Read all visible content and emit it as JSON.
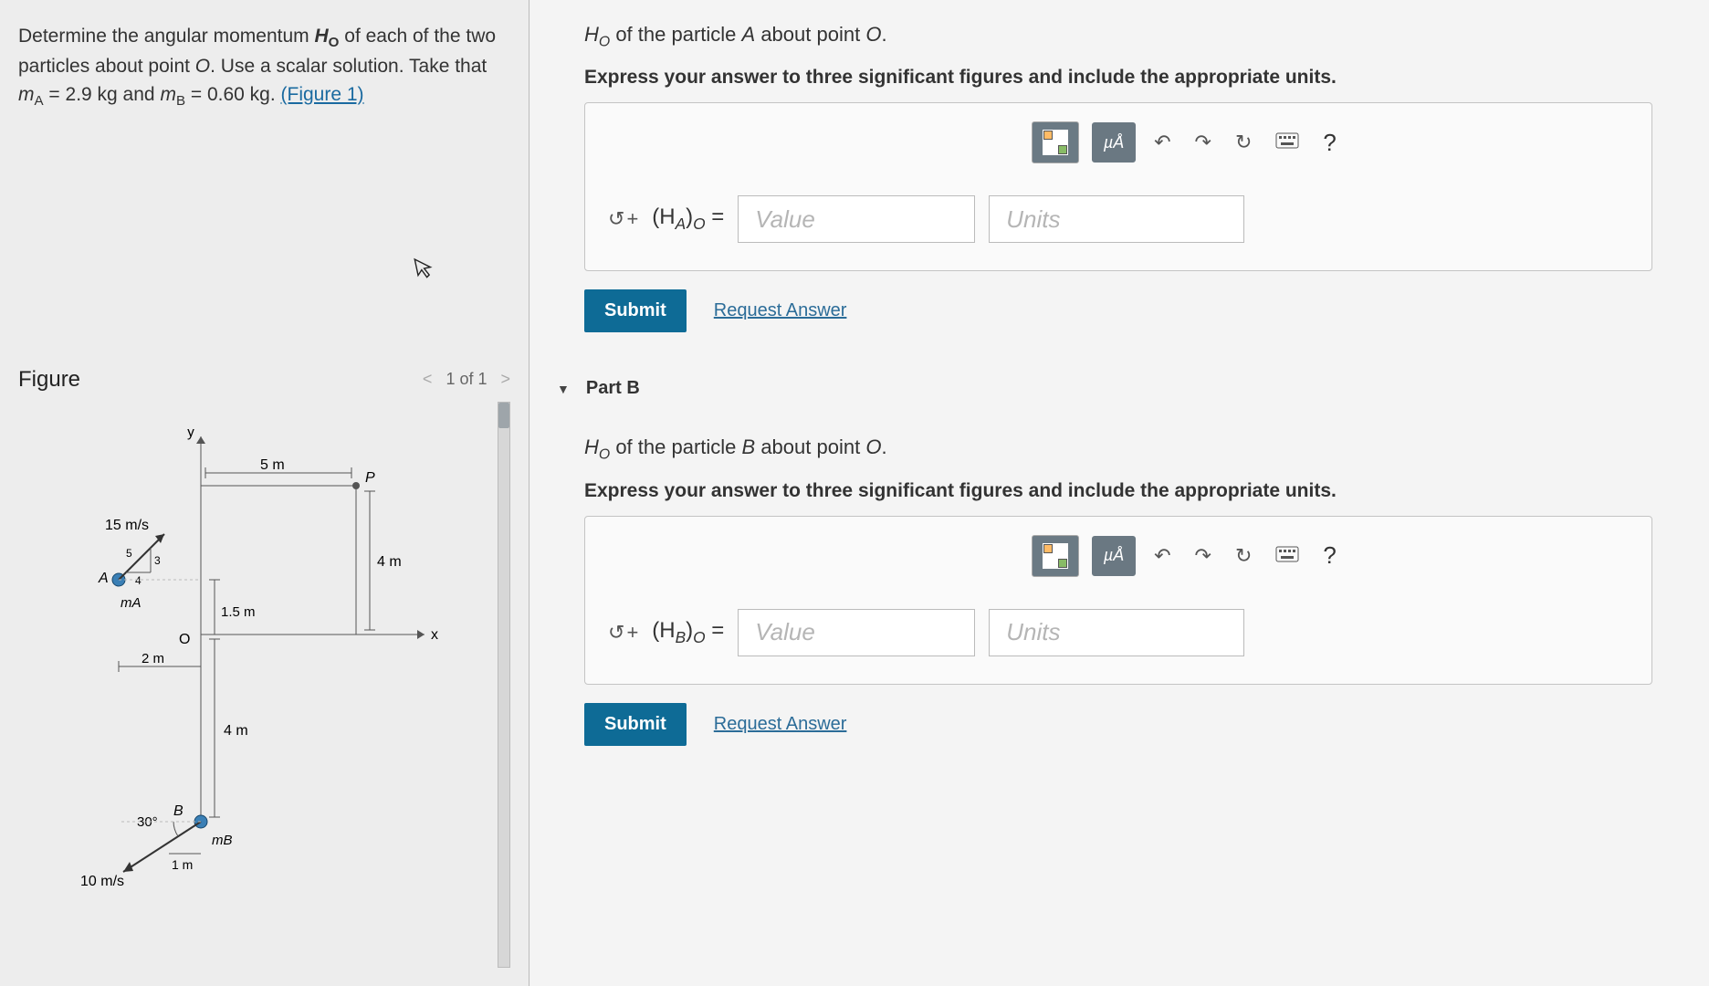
{
  "problem": {
    "line1_a": "Determine the angular momentum ",
    "line1_var": "H",
    "line1_sub": "O",
    "line1_b": " of each of the two particles about point ",
    "line1_pt": "O",
    "line1_c": ". Use a scalar solution. Take that ",
    "line2_a": "m",
    "line2_aSub": "A",
    "line2_b": " = 2.9 kg and ",
    "line2_c": "m",
    "line2_cSub": "B",
    "line2_d": " = 0.60 kg. ",
    "figure_link": "(Figure 1)"
  },
  "figure": {
    "title": "Figure",
    "nav_prev": "<",
    "nav_label": "1 of 1",
    "nav_next": ">",
    "labels": {
      "y": "y",
      "x": "x",
      "five_m": "5 m",
      "P": "P",
      "fifteen": "15 m/s",
      "angle3": "3",
      "angle4": "4",
      "angle5": "5",
      "A": "A",
      "mA": "mA",
      "four_m_top": "4 m",
      "O": "O",
      "onep5": "1.5 m",
      "two_m": "2 m",
      "four_m": "4 m",
      "thirty": "30°",
      "B": "B",
      "mB": "mB",
      "ten": "10 m/s",
      "one_m": "1 m"
    }
  },
  "partA": {
    "prompt_a": "H",
    "prompt_sub": "O",
    "prompt_b": " of the particle ",
    "prompt_particle": "A",
    "prompt_c": " about point ",
    "prompt_pt": "O",
    "instruction": "Express your answer to three significant figures and include the appropriate units.",
    "units_btn": "µÅ",
    "help": "?",
    "sign_sym": "↺",
    "sign_label": "+",
    "eq_a": "(H",
    "eq_sub": "A",
    "eq_b": ")",
    "eq_sub2": "O",
    "eq_c": " =",
    "value_ph": "Value",
    "units_ph": "Units",
    "submit": "Submit",
    "request": "Request Answer"
  },
  "partB": {
    "header": "Part B",
    "prompt_a": "H",
    "prompt_sub": "O",
    "prompt_b": " of the particle ",
    "prompt_particle": "B",
    "prompt_c": " about point ",
    "prompt_pt": "O",
    "instruction": "Express your answer to three significant figures and include the appropriate units.",
    "units_btn": "µÅ",
    "help": "?",
    "sign_sym": "↺",
    "sign_label": "+",
    "eq_a": "(H",
    "eq_sub": "B",
    "eq_b": ")",
    "eq_sub2": "O",
    "eq_c": " =",
    "value_ph": "Value",
    "units_ph": "Units",
    "submit": "Submit",
    "request": "Request Answer"
  }
}
